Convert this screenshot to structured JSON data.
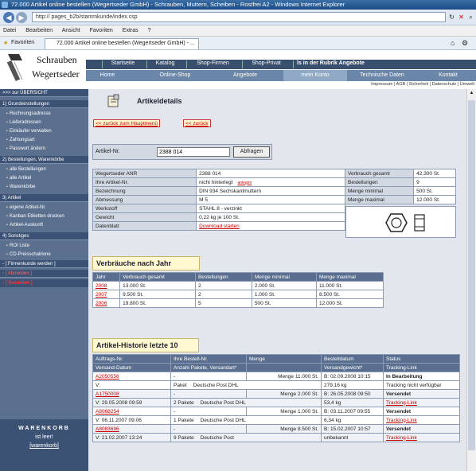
{
  "browser": {
    "title": "72.000 Artikel online bestellen (Wegertseder GmbH) - Schrauben, Muttern, Scheiben - Rostfrei A2 - Windows Internet Explorer",
    "url": "http://            pages_b2b/stammkunde/index.csp",
    "menu": [
      "Datei",
      "Bearbeiten",
      "Ansicht",
      "Favoriten",
      "Extras",
      "?"
    ],
    "favorites_label": "Favoriten",
    "tab_title": "72.000 Artikel online bestellen (Wegertseder GmbH) - ..."
  },
  "site": {
    "logo_line1": "Schrauben",
    "logo_line2": "Wegertseder",
    "top_nav": [
      "Startseite",
      "Katalog",
      "Shop-Firmen",
      "Shop-Privat",
      "ls in der Rubrik Angebote"
    ],
    "main_nav": [
      "Home",
      "Online-Shop",
      "Angebote",
      "mein Konto",
      "Technische Daten",
      "Kontakt"
    ],
    "utility": "Impressum | AGB | Sicherheit | Datenschutz | Umwelt"
  },
  "sidebar": {
    "overview": ">>> zur ÜBERSICHT",
    "groups": [
      {
        "title": "1)  Grundeinstellungen",
        "items": [
          "Rechnungsadresse",
          "Lieferadressen",
          "Einkäufer verwalten",
          "Zahlungsart",
          "Passwort ändern"
        ]
      },
      {
        "title": "2)  Bestellungen, Warenkörbe",
        "items": [
          "alle Bestellungen",
          "alle Artikel",
          "Warenkörbe"
        ]
      },
      {
        "title": "3)  Artikel",
        "items": [
          "eigene Artikel-Nr.",
          "Kanban Etiketten drucken",
          "Artikel-Auskunft"
        ]
      },
      {
        "title": "4)  Sonstiges",
        "items": [
          "ROI Liste",
          "CD-Preisschablone"
        ]
      }
    ],
    "firmenkunde": "- [ Firmenkunde werden ]",
    "abmelden": "- [ Abmelden ]",
    "bestellen": "- [ Bestellen ]",
    "cart_title": "WARENKORB",
    "cart_status": "ist leer!",
    "cart_link": "[warenkorb]"
  },
  "content": {
    "heading": "Artikeldetails",
    "back_main": "<< zurück zum Hauptmenü",
    "back": "<< zurück",
    "artnr_label": "Artikel-Nr.",
    "artnr_value": "2388 014",
    "query_button": "Abfragen",
    "details_left": [
      [
        "Wegertseder ANR",
        "2388 014"
      ],
      [
        "Ihre Artikel-Nr.",
        "nicht hinterlegt"
      ],
      [
        "Bezeichnung",
        "DIN 934 Sechskantmuttern"
      ],
      [
        "Abmessung",
        "M 5"
      ],
      [
        "Werkstoff",
        "STAHL 8 - verzinkt"
      ],
      [
        "Gewicht",
        "0,22 kg je 100 St."
      ],
      [
        "Datenblatt",
        "Download starten"
      ]
    ],
    "anlegen": "anlegen",
    "details_right": [
      [
        "Verbrauch gesamt",
        "42.300 St."
      ],
      [
        "Bestellungen",
        "9"
      ],
      [
        "Menge minimal",
        "500 St."
      ],
      [
        "Menge maximal",
        "12.000 St."
      ]
    ],
    "year_title": "Verbräuche nach Jahr",
    "year_headers": [
      "Jahr",
      "Verbrauch gesamt",
      "Bestellungen",
      "Menge minimal",
      "Menge maximal"
    ],
    "year_rows": [
      [
        "2008",
        "13.000 St.",
        "2",
        "2.000 St.",
        "11.000 St."
      ],
      [
        "2007",
        "9.500 St.",
        "2",
        "1.000 St.",
        "8.500 St."
      ],
      [
        "2006",
        "19.800 St.",
        "5",
        "500 St.",
        "12.000 St."
      ]
    ],
    "hist_title": "Artikel-Historie   letzte 10",
    "hist_headers1": [
      "Auftrags-Nr.",
      "Ihre Bestell-Nr.",
      "Menge",
      "Bestelldatum",
      "Status"
    ],
    "hist_headers2": [
      "Versand-Datum",
      "Anzahl Pakete, Versandart*",
      "",
      "Versandgewicht*",
      "Tracking-Link"
    ],
    "hist_rows": [
      {
        "nr": "A2050556",
        "best": "-",
        "menge": "Menge 11.000 St.",
        "datum": "B: 02.09.2008 10:15",
        "status": "In Bearbeitung",
        "vdatum": "V:",
        "pakete": "Paket",
        "versandart": "Deutsche Post DHL",
        "gewicht": "279,16 kg",
        "track": "Tracking nicht verfügbar"
      },
      {
        "nr": "A1750008",
        "best": "-",
        "menge": "Menge 2.000 St.",
        "datum": "B: 26.05.2008 09:50",
        "status": "Versendet",
        "vdatum": "V: 29.05.2008 09:59",
        "pakete": "2 Pakete",
        "versandart": "Deutsche Post DHL",
        "gewicht": "53,4 kg",
        "track": "Tracking-Link"
      },
      {
        "nr": "A8068254",
        "best": "-",
        "menge": "Menge 1.000 St.",
        "datum": "B: 03.11.2007 09:55",
        "status": "Versendet",
        "vdatum": "V: 06.11.2007 09:06",
        "pakete": "1 Pakete",
        "versandart": "Deutsche Post DHL",
        "gewicht": "6,34 kg",
        "track": "Tracking-Link"
      },
      {
        "nr": "A8083696",
        "best": "-",
        "menge": "Menge 8.500 St.",
        "datum": "B: 15.02.2007 10:57",
        "status": "Versendet",
        "vdatum": "V: 21.02.2007 13:24",
        "pakete": "9 Pakete",
        "versandart": "Deutsche Post",
        "gewicht": "unbekannt",
        "track": "Tracking-Link"
      }
    ]
  }
}
